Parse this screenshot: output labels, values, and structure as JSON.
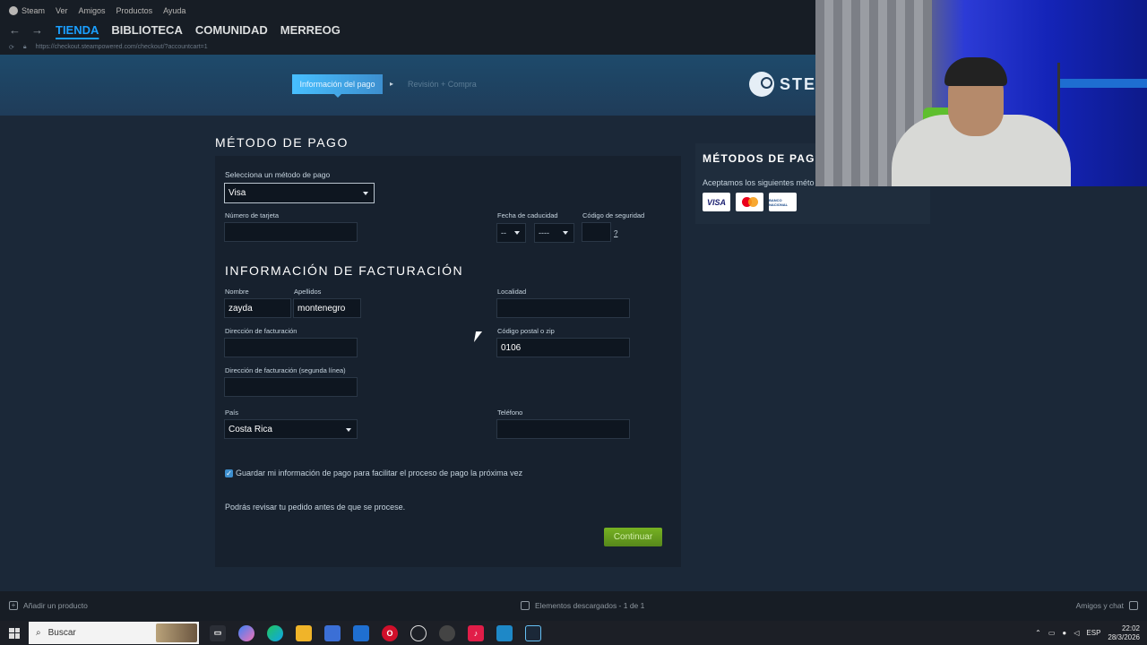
{
  "menu": {
    "app": "Steam",
    "items": [
      "Ver",
      "Amigos",
      "Productos",
      "Ayuda"
    ]
  },
  "nav": {
    "back": "←",
    "forward": "→",
    "tabs": [
      "TIENDA",
      "BIBLIOTECA",
      "COMUNIDAD",
      "MERREOG"
    ],
    "active_tab": "TIENDA"
  },
  "url": "https://checkout.steampowered.com/checkout/?accountcart=1",
  "steps": {
    "current": "Información del pago",
    "next": "Revisión + Compra",
    "brand": "STEA"
  },
  "payment": {
    "title": "MÉTODO DE PAGO",
    "select_label": "Selecciona un método de pago",
    "select_value": "Visa",
    "card_number_label": "Número de tarjeta",
    "card_number_value": "",
    "expiry_label": "Fecha de caducidad",
    "expiry_month": "--",
    "expiry_year": "----",
    "security_label": "Código de seguridad",
    "security_help": "?"
  },
  "billing": {
    "title": "INFORMACIÓN DE FACTURACIÓN",
    "first_name_label": "Nombre",
    "first_name_value": "zayda",
    "last_name_label": "Apellidos",
    "last_name_value": "montenegro",
    "city_label": "Localidad",
    "city_value": "",
    "address_label": "Dirección de facturación",
    "address_value": "",
    "zip_label": "Código postal o zip",
    "zip_value": "0106",
    "address2_label": "Dirección de facturación (segunda línea)",
    "address2_value": "",
    "country_label": "País",
    "country_value": "Costa Rica",
    "phone_label": "Teléfono",
    "phone_value": ""
  },
  "save_info": {
    "checked": true,
    "label": "Guardar mi información de pago para facilitar el proceso de pago la próxima vez"
  },
  "review_note": "Podrás revisar tu pedido antes de que se procese.",
  "continue_label": "Continuar",
  "sidebar": {
    "title": "MÉTODOS DE PAGO",
    "text": "Aceptamos los siguientes méto",
    "cards": [
      "VISA",
      "mastercard",
      "BANCO NACIONAL"
    ]
  },
  "footer": {
    "add_product": "Añadir un producto",
    "downloads": "Elementos descargados - 1 de 1",
    "friends": "Amigos y chat"
  },
  "taskbar": {
    "search": "Buscar",
    "lang": "ESP",
    "time": "22:02",
    "date": "28/3/2026"
  },
  "colors": {
    "accent": "#1a9fff",
    "button": "#75b022",
    "background": "#1b2838"
  }
}
